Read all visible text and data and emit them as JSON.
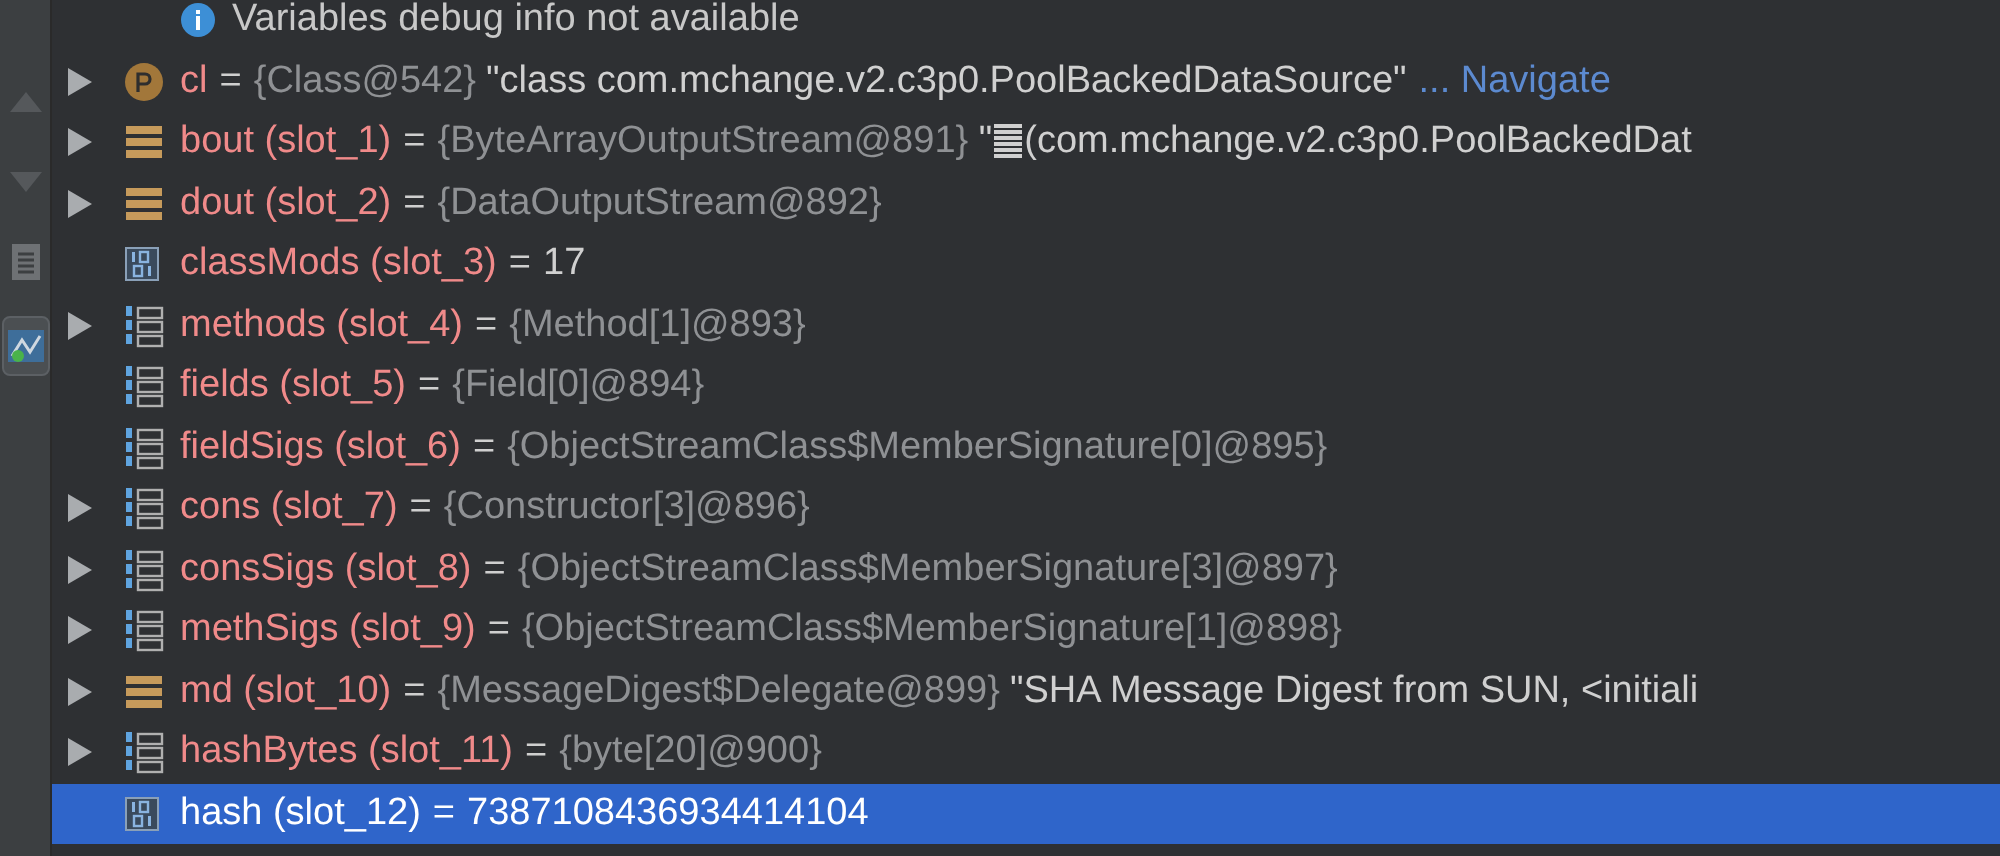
{
  "toolbar": [
    {
      "kind": "up",
      "selected": false
    },
    {
      "kind": "down",
      "selected": false
    },
    {
      "kind": "document",
      "selected": false
    },
    {
      "kind": "image",
      "selected": true
    }
  ],
  "notice": {
    "text": "Variables debug info not available"
  },
  "variables": [
    {
      "kind": "protected",
      "expandable": true,
      "selected": false,
      "name": "cl",
      "equals": "=",
      "type": "{Class@542}",
      "value": "\"class com.mchange.v2.c3p0.PoolBackedDataSource\"",
      "link": "... Navigate"
    },
    {
      "kind": "object",
      "expandable": true,
      "selected": false,
      "name": "bout (slot_1)",
      "equals": "=",
      "type": "{ByteArrayOutputStream@891}",
      "value_before_glyph": "\"",
      "value": "(com.mchange.v2.c3p0.PoolBackedDat"
    },
    {
      "kind": "object",
      "expandable": true,
      "selected": false,
      "name": "dout (slot_2)",
      "equals": "=",
      "type": "{DataOutputStream@892}"
    },
    {
      "kind": "primitive",
      "expandable": false,
      "selected": false,
      "name": "classMods (slot_3)",
      "equals": "=",
      "value": "17"
    },
    {
      "kind": "array",
      "expandable": true,
      "selected": false,
      "name": "methods (slot_4)",
      "equals": "=",
      "type": "{Method[1]@893}"
    },
    {
      "kind": "array",
      "expandable": false,
      "selected": false,
      "name": "fields (slot_5)",
      "equals": "=",
      "type": "{Field[0]@894}"
    },
    {
      "kind": "array",
      "expandable": false,
      "selected": false,
      "name": "fieldSigs (slot_6)",
      "equals": "=",
      "type": "{ObjectStreamClass$MemberSignature[0]@895}"
    },
    {
      "kind": "array",
      "expandable": true,
      "selected": false,
      "name": "cons (slot_7)",
      "equals": "=",
      "type": "{Constructor[3]@896}"
    },
    {
      "kind": "array",
      "expandable": true,
      "selected": false,
      "name": "consSigs (slot_8)",
      "equals": "=",
      "type": "{ObjectStreamClass$MemberSignature[3]@897}"
    },
    {
      "kind": "array",
      "expandable": true,
      "selected": false,
      "name": "methSigs (slot_9)",
      "equals": "=",
      "type": "{ObjectStreamClass$MemberSignature[1]@898}"
    },
    {
      "kind": "object",
      "expandable": true,
      "selected": false,
      "name": "md (slot_10)",
      "equals": "=",
      "type": "{MessageDigest$Delegate@899}",
      "value": "\"SHA Message Digest from SUN, <initiali"
    },
    {
      "kind": "array",
      "expandable": true,
      "selected": false,
      "name": "hashBytes (slot_11)",
      "equals": "=",
      "type": "{byte[20]@900}"
    },
    {
      "kind": "primitive",
      "expandable": false,
      "selected": true,
      "name": "hash (slot_12)",
      "equals": "=",
      "value": "7387108436934414104"
    }
  ]
}
